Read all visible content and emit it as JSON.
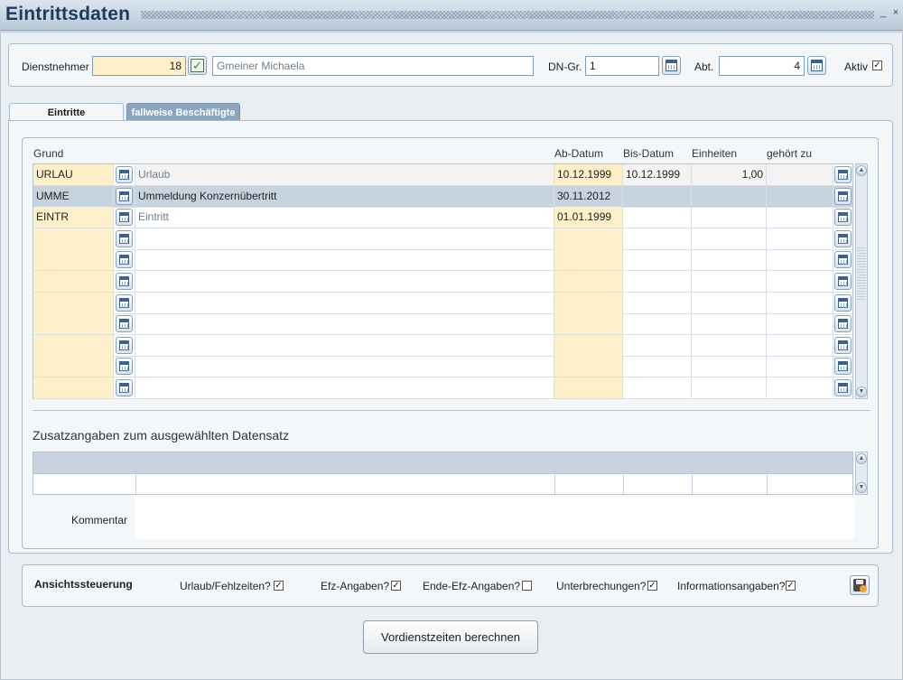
{
  "window": {
    "title": "Eintrittsdaten",
    "minimize_glyph": "_",
    "close_glyph": "×"
  },
  "header": {
    "dienstnehmer_label": "Dienstnehmer",
    "dienstnehmer_value": "18",
    "name_value": "Gmeiner Michaela",
    "dn_gr_label": "DN-Gr.",
    "dn_gr_value": "1",
    "abt_label": "Abt.",
    "abt_value": "4",
    "aktiv_label": "Aktiv",
    "aktiv_checked": "✓"
  },
  "tabs": [
    {
      "label": "Eintritte"
    },
    {
      "label": "fallweise Beschäftigte"
    }
  ],
  "grid": {
    "columns": {
      "grund": "Grund",
      "ab_datum": "Ab-Datum",
      "bis_datum": "Bis-Datum",
      "einheiten": "Einheiten",
      "gehoert_zu": "gehört zu"
    },
    "rows": [
      {
        "code": "URLAU",
        "desc": "Urlaub",
        "ab": "10.12.1999",
        "bis": "10.12.1999",
        "einheiten": "1,00",
        "gehoert": ""
      },
      {
        "code": "UMME",
        "desc": "Ummeldung Konzernübertritt",
        "ab": "30.11.2012",
        "bis": "",
        "einheiten": "",
        "gehoert": ""
      },
      {
        "code": "EINTR",
        "desc": "Eintritt",
        "ab": "01.01.1999",
        "bis": "",
        "einheiten": "",
        "gehoert": ""
      },
      {
        "code": "",
        "desc": "",
        "ab": "",
        "bis": "",
        "einheiten": "",
        "gehoert": ""
      },
      {
        "code": "",
        "desc": "",
        "ab": "",
        "bis": "",
        "einheiten": "",
        "gehoert": ""
      },
      {
        "code": "",
        "desc": "",
        "ab": "",
        "bis": "",
        "einheiten": "",
        "gehoert": ""
      },
      {
        "code": "",
        "desc": "",
        "ab": "",
        "bis": "",
        "einheiten": "",
        "gehoert": ""
      },
      {
        "code": "",
        "desc": "",
        "ab": "",
        "bis": "",
        "einheiten": "",
        "gehoert": ""
      },
      {
        "code": "",
        "desc": "",
        "ab": "",
        "bis": "",
        "einheiten": "",
        "gehoert": ""
      },
      {
        "code": "",
        "desc": "",
        "ab": "",
        "bis": "",
        "einheiten": "",
        "gehoert": ""
      },
      {
        "code": "",
        "desc": "",
        "ab": "",
        "bis": "",
        "einheiten": "",
        "gehoert": ""
      }
    ]
  },
  "zusatz": {
    "title": "Zusatzangaben zum ausgewählten Datensatz",
    "kommentar_label": "Kommentar"
  },
  "view": {
    "title": "Ansichtssteuerung",
    "options": [
      {
        "label": "Urlaub/Fehlzeiten?",
        "checked": "✓"
      },
      {
        "label": "Efz-Angaben?",
        "checked": "✓"
      },
      {
        "label": "Ende-Efz-Angaben?",
        "checked": ""
      },
      {
        "label": "Unterbrechungen?",
        "checked": "✓"
      },
      {
        "label": "Informationsangaben?",
        "checked": "✓"
      }
    ]
  },
  "actions": {
    "calc_label": "Vordienstzeiten berechnen"
  },
  "colors": {
    "title": "#1d3a5c",
    "required_field": "#fdf0c8",
    "selected_row": "#c7d4e0",
    "tab_inactive": "#8aa6bf"
  }
}
